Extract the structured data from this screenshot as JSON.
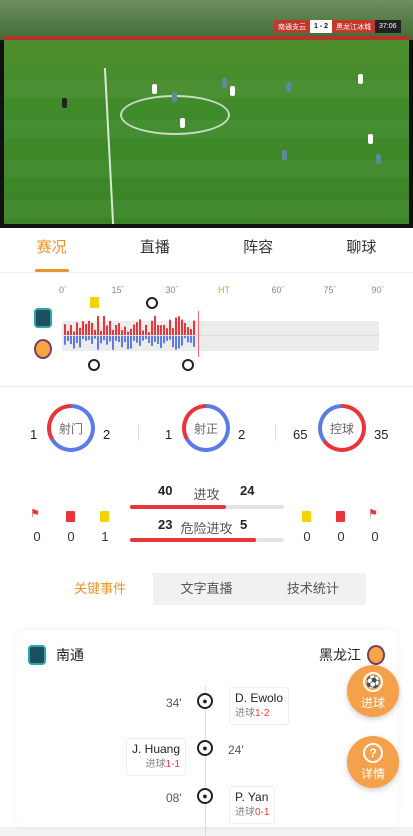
{
  "video": {
    "home_abbr": "南通支云",
    "score": "1 - 2",
    "away_abbr": "黑龙江冰城",
    "clock": "37:06"
  },
  "tabs": [
    "赛况",
    "直播",
    "阵容",
    "聊球"
  ],
  "timeline": {
    "ticks": [
      "0`",
      "15`",
      "30`",
      "HT",
      "60`",
      "75`",
      "90`"
    ]
  },
  "stats": {
    "shots": {
      "label": "射门",
      "home": "1",
      "away": "2"
    },
    "on_target": {
      "label": "射正",
      "home": "1",
      "away": "2"
    },
    "possession": {
      "label": "控球",
      "home": "65",
      "away": "35",
      "home_pct": 65
    },
    "attacks": {
      "label": "进攻",
      "home": "40",
      "away": "24"
    },
    "dangerous": {
      "label": "危险进攻",
      "home": "23",
      "away": "5"
    },
    "home_counts": {
      "corners": "0",
      "red": "0",
      "yellow": "1"
    },
    "away_counts": {
      "yellow": "0",
      "red": "0",
      "corners": "0"
    }
  },
  "segments": [
    "关键事件",
    "文字直播",
    "技术统计"
  ],
  "events": {
    "home_team": "南通",
    "away_team": "黑龙江",
    "items": [
      {
        "minute": "34'",
        "player": "D. Ewolo",
        "sub_label": "进球",
        "score": "1-2",
        "side": "away"
      },
      {
        "minute": "24'",
        "player": "J. Huang",
        "sub_label": "进球",
        "score": "1-1",
        "side": "home"
      },
      {
        "minute": "08'",
        "player": "P. Yan",
        "sub_label": "进球",
        "score": "0-1",
        "side": "away"
      }
    ]
  },
  "fabs": {
    "goal": {
      "icon": "⚽",
      "label": "进球"
    },
    "detail": {
      "icon": "?",
      "label": "详情"
    }
  },
  "colors": {
    "accent": "#e8952c",
    "red": "#e9353a",
    "blue": "#5b7be8"
  }
}
